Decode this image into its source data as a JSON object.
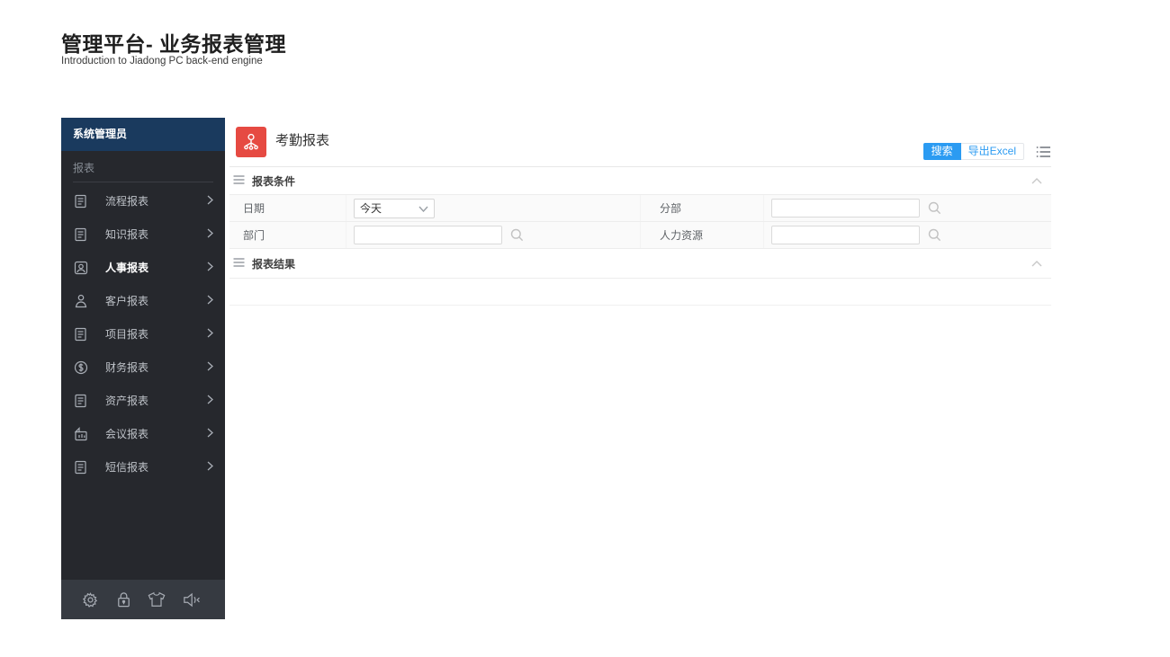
{
  "page": {
    "title": "管理平台- 业务报表管理",
    "subtitle": "Introduction to Jiadong PC back-end engine"
  },
  "sidebar": {
    "header": "系统管理员",
    "section": "报表",
    "items": [
      {
        "label": "流程报表",
        "icon": "document-icon"
      },
      {
        "label": "知识报表",
        "icon": "document-icon"
      },
      {
        "label": "人事报表",
        "icon": "person-badge-icon",
        "active": true
      },
      {
        "label": "客户报表",
        "icon": "person-icon"
      },
      {
        "label": "项目报表",
        "icon": "document-icon"
      },
      {
        "label": "财务报表",
        "icon": "dollar-circle-icon"
      },
      {
        "label": "资产报表",
        "icon": "document-icon"
      },
      {
        "label": "会议报表",
        "icon": "meeting-chart-icon"
      },
      {
        "label": "短信报表",
        "icon": "document-icon"
      }
    ],
    "footer_icons": [
      "gear-icon",
      "lock-icon",
      "shirt-icon",
      "speaker-icon",
      "collapse-arrow-icon"
    ]
  },
  "content": {
    "title": "考勤报表",
    "toolbar": {
      "search": "搜索",
      "export": "导出Excel"
    },
    "conditions_title": "报表条件",
    "results_title": "报表结果",
    "fields": {
      "date": {
        "label": "日期",
        "value": "今天"
      },
      "branch": {
        "label": "分部",
        "value": ""
      },
      "department": {
        "label": "部门",
        "value": ""
      },
      "hr": {
        "label": "人力资源",
        "value": ""
      }
    }
  },
  "colors": {
    "accent_blue": "#2b9bf2",
    "app_icon_red": "#e64a42",
    "sidebar_header_bg": "#1a3a5e",
    "sidebar_bg": "#26282d"
  }
}
